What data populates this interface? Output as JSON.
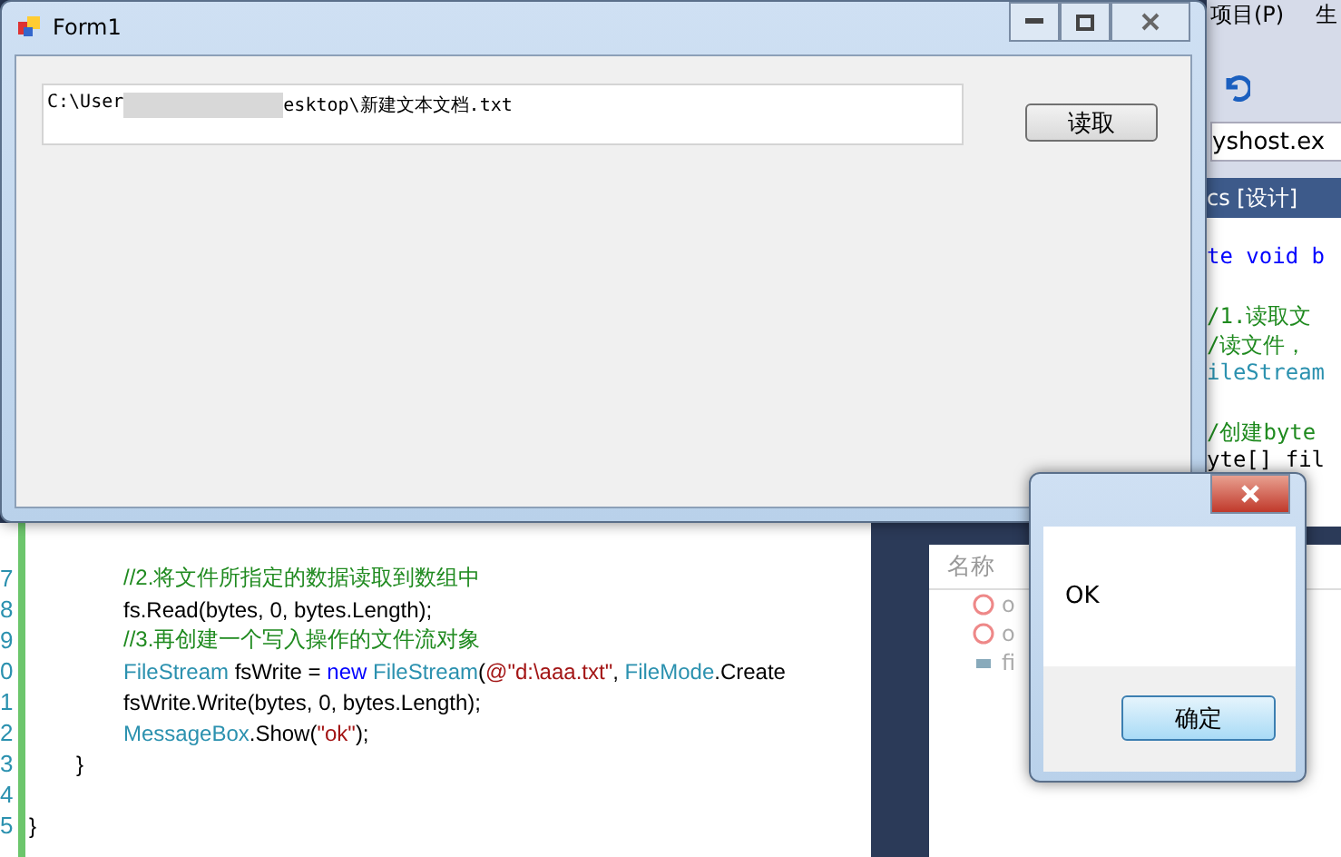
{
  "ide": {
    "menu": [
      "项目(P)",
      "生"
    ],
    "combo": "yshost.ex",
    "tab": "cs [设计]",
    "right_code": [
      {
        "kind": "keyword",
        "text": "te void b"
      },
      {
        "kind": "blank"
      },
      {
        "kind": "comment",
        "text": "/1.读取文"
      },
      {
        "kind": "comment",
        "text": "/读文件，"
      },
      {
        "kind": "type",
        "text": "ileStream"
      },
      {
        "kind": "blank"
      },
      {
        "kind": "comment",
        "text": "/创建byte"
      },
      {
        "kind": "plain",
        "text": "yte[] fil"
      }
    ],
    "code_lines": [
      {
        "number": "7",
        "kind": "statement",
        "tokens": [
          {
            "kind": "comment",
            "text": "//2.将文件所指定的数据读取到数组中"
          }
        ]
      },
      {
        "number": "8",
        "kind": "statement",
        "tokens": [
          {
            "kind": "plain",
            "text": "fs.Read(bytes, 0, bytes.Length);"
          }
        ]
      },
      {
        "number": "9",
        "kind": "statement",
        "tokens": [
          {
            "kind": "comment",
            "text": "//3.再创建一个写入操作的文件流对象"
          }
        ]
      },
      {
        "number": "0",
        "kind": "statement",
        "tokens": [
          {
            "kind": "type",
            "text": "FileStream"
          },
          {
            "kind": "plain",
            "text": " fsWrite = "
          },
          {
            "kind": "keyword",
            "text": "new"
          },
          {
            "kind": "type",
            "text": " FileStream"
          },
          {
            "kind": "plain",
            "text": "("
          },
          {
            "kind": "string",
            "text": "@\"d:\\aaa.txt\""
          },
          {
            "kind": "plain",
            "text": ", "
          },
          {
            "kind": "type",
            "text": "FileMode"
          },
          {
            "kind": "plain",
            "text": ".Create"
          }
        ]
      },
      {
        "number": "1",
        "kind": "statement",
        "tokens": [
          {
            "kind": "plain",
            "text": "fsWrite.Write(bytes, 0, bytes.Length);"
          }
        ]
      },
      {
        "number": "2",
        "kind": "statement",
        "tokens": [
          {
            "kind": "type",
            "text": "MessageBox"
          },
          {
            "kind": "plain",
            "text": ".Show("
          },
          {
            "kind": "string",
            "text": "\"ok\""
          },
          {
            "kind": "plain",
            "text": ");"
          }
        ]
      },
      {
        "number": "3",
        "kind": "method_end",
        "tokens": [
          {
            "kind": "plain",
            "text": "}"
          }
        ]
      },
      {
        "number": "4"
      },
      {
        "number": "5",
        "kind": "class_end",
        "tokens": [
          {
            "kind": "plain",
            "text": "}"
          }
        ]
      }
    ],
    "watch": {
      "column": "名称",
      "rows": [
        {
          "kind": "error",
          "text": "o"
        },
        {
          "kind": "error",
          "text": "o"
        },
        {
          "kind": "object",
          "text": "fi"
        }
      ]
    }
  },
  "form": {
    "title": "Form1",
    "path_start": "C:\\User",
    "path_end": "esktop\\新建文本文档.txt",
    "button": "读取"
  },
  "message_box": {
    "text": "OK",
    "button": "确定"
  }
}
